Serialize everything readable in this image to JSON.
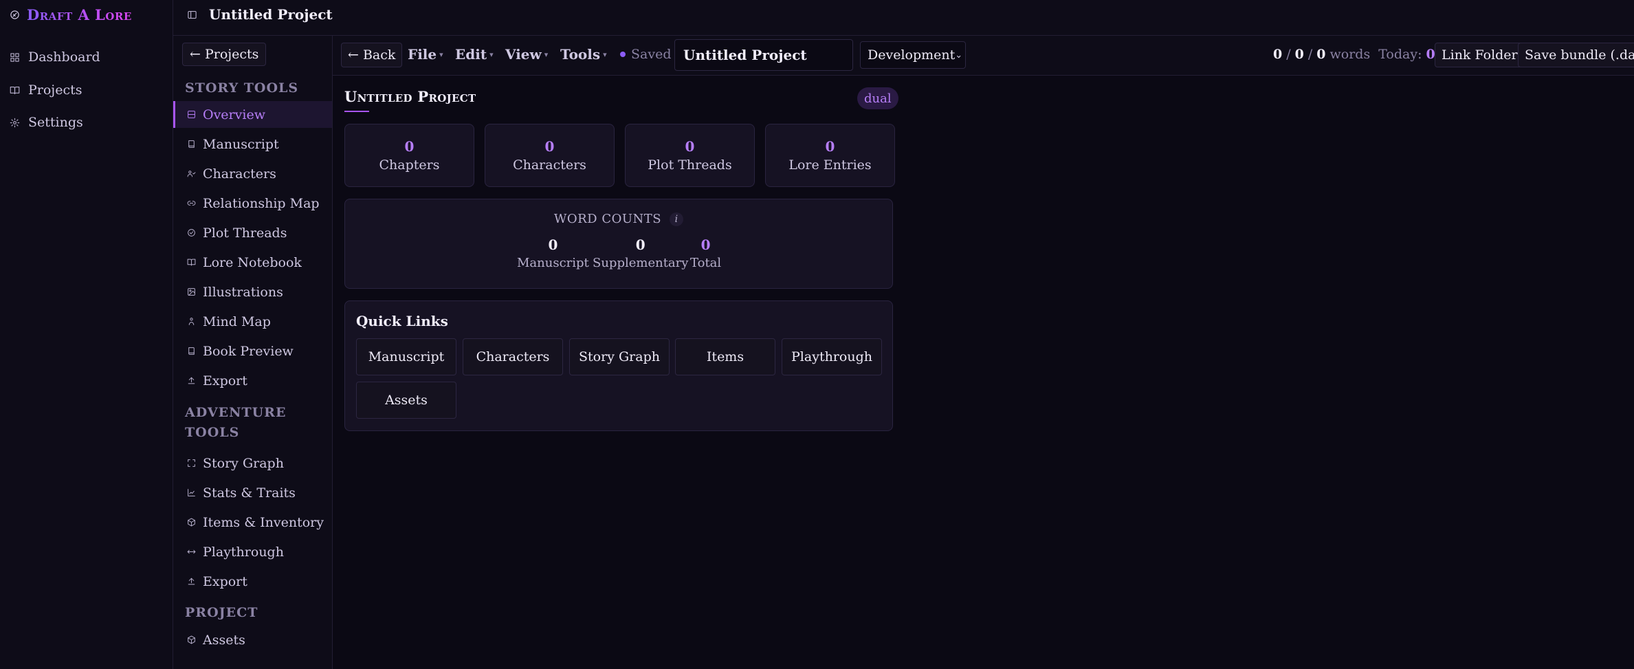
{
  "brand": {
    "name": "Draft A Lore"
  },
  "rail": {
    "items": [
      {
        "label": "Dashboard",
        "icon": "grid-icon"
      },
      {
        "label": "Projects",
        "icon": "book-open-icon"
      },
      {
        "label": "Settings",
        "icon": "gear-icon"
      }
    ]
  },
  "header": {
    "title": "Untitled Project"
  },
  "tools": {
    "projects_button": "← Projects",
    "story_label": "STORY TOOLS",
    "story_items": [
      {
        "label": "Overview",
        "icon": "layout-icon",
        "active": true
      },
      {
        "label": "Manuscript",
        "icon": "book-icon"
      },
      {
        "label": "Characters",
        "icon": "users-icon"
      },
      {
        "label": "Relationship Map",
        "icon": "link-icon"
      },
      {
        "label": "Plot Threads",
        "icon": "check-circle-icon"
      },
      {
        "label": "Lore Notebook",
        "icon": "book-open-icon"
      },
      {
        "label": "Illustrations",
        "icon": "image-icon"
      },
      {
        "label": "Mind Map",
        "icon": "person-icon"
      },
      {
        "label": "Book Preview",
        "icon": "book-icon"
      },
      {
        "label": "Export",
        "icon": "upload-icon"
      }
    ],
    "adventure_label": "ADVENTURE TOOLS",
    "adventure_items": [
      {
        "label": "Story Graph",
        "icon": "scan-icon"
      },
      {
        "label": "Stats & Traits",
        "icon": "chart-icon"
      },
      {
        "label": "Items & Inventory",
        "icon": "package-icon"
      },
      {
        "label": "Playthrough",
        "icon": "arrows-icon"
      },
      {
        "label": "Export",
        "icon": "upload-icon"
      }
    ],
    "project_label": "PROJECT",
    "project_items": [
      {
        "label": "Assets",
        "icon": "cube-icon"
      }
    ]
  },
  "toolbar": {
    "back_label": "← Back",
    "menus": [
      "File",
      "Edit",
      "View",
      "Tools"
    ],
    "saved_label": "Saved",
    "title_value": "Untitled Project",
    "mode_value": "Development",
    "words": {
      "a": "0",
      "b": "0",
      "c": "0",
      "sep": "/",
      "unit": "words",
      "today_label": "Today:",
      "today_value": "0"
    },
    "link_folder_label": "Link Folder",
    "save_bundle_label": "Save bundle (.dalz)"
  },
  "overview": {
    "title": "Untitled Project",
    "badge": "dual",
    "stats": [
      {
        "value": "0",
        "label": "Chapters"
      },
      {
        "value": "0",
        "label": "Characters"
      },
      {
        "value": "0",
        "label": "Plot Threads"
      },
      {
        "value": "0",
        "label": "Lore Entries"
      }
    ],
    "word_counts": {
      "title": "WORD COUNTS",
      "info": "i",
      "items": [
        {
          "value": "0",
          "label": "Manuscript"
        },
        {
          "value": "0",
          "label": "Supplementary"
        },
        {
          "value": "0",
          "label": "Total"
        }
      ]
    },
    "quick_links": {
      "title": "Quick Links",
      "items": [
        "Manuscript",
        "Characters",
        "Story Graph",
        "Items",
        "Playthrough",
        "Assets"
      ]
    }
  },
  "colors": {
    "accent": "#a855f7",
    "background": "#0b0914",
    "panel": "#161223"
  }
}
